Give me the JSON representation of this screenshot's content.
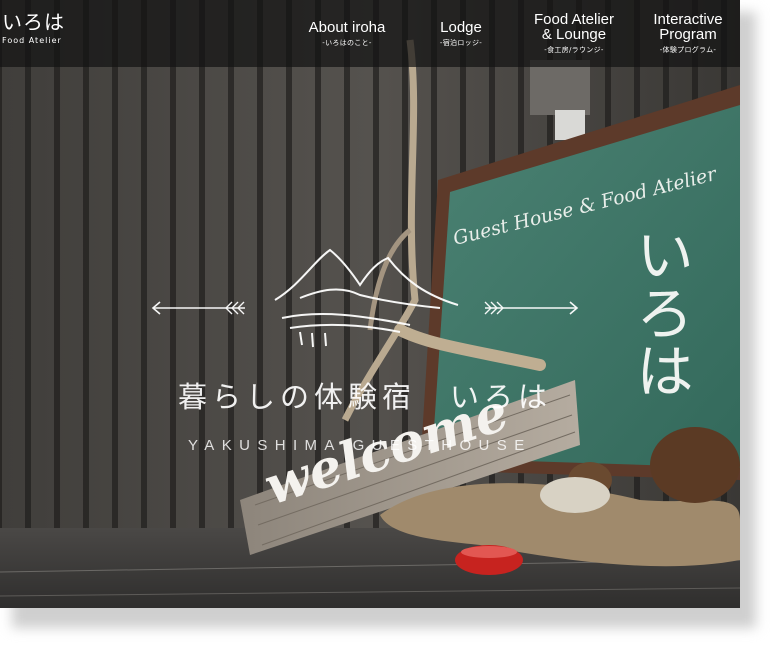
{
  "site": {
    "logo": {
      "main": "いろは",
      "sub": "Food Atelier"
    }
  },
  "nav": [
    {
      "label": "About iroha",
      "sub": "-いろはのこと-"
    },
    {
      "label": "Lodge",
      "sub": "-宿泊ロッジ-"
    },
    {
      "label": "Food Atelier\n& Lounge",
      "sub": "-食工房/ラウンジ-"
    },
    {
      "label": "Interactive\nProgram",
      "sub": "-体験プログラム-"
    }
  ],
  "hero": {
    "tagline": "暮らしの体験宿　いろは",
    "subtitle": "YAKUSHIMA GUESTHOUSE",
    "chalkboard_text": "Guest House & Food Atelier",
    "chalkboard_kana": "いろは",
    "sign_text": "welcome"
  },
  "colors": {
    "header_bg": "#141414",
    "chalkboard": "#3f7566",
    "wall": "#3a3836"
  }
}
